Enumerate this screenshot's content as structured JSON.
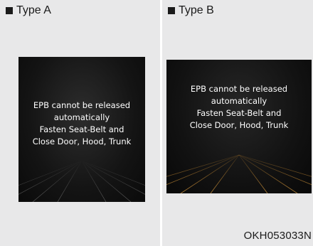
{
  "panels": [
    {
      "label": "Type A",
      "message": [
        "EPB cannot be released",
        "automatically",
        "Fasten Seat-Belt and",
        "Close Door, Hood, Trunk"
      ]
    },
    {
      "label": "Type B",
      "message": [
        "EPB cannot be released",
        "automatically",
        "Fasten Seat-Belt and",
        "Close Door, Hood, Trunk"
      ]
    }
  ],
  "image_code": "OKH053033N",
  "colors": {
    "panel_background": "#e8e8e9",
    "screen_background": "#141414",
    "message_text": "#ffffff",
    "type_b_accent": "#c8872a"
  }
}
